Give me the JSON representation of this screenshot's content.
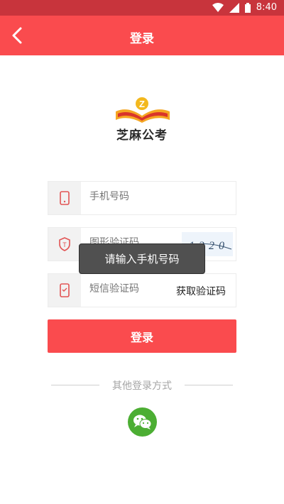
{
  "status_bar": {
    "time": "8:40",
    "icons": [
      "wifi-icon",
      "signal-icon",
      "battery-icon"
    ]
  },
  "header": {
    "title": "登录",
    "back_icon": "chevron-left-icon"
  },
  "logo": {
    "text": "芝麻公考",
    "badge_letter": "Z"
  },
  "form": {
    "phone": {
      "placeholder": "手机号码",
      "icon": "phone-icon"
    },
    "captcha": {
      "placeholder": "图形验证码",
      "icon": "shield-icon",
      "image_text": "1320"
    },
    "sms": {
      "placeholder": "短信验证码",
      "icon": "message-icon",
      "get_code_label": "获取验证码"
    }
  },
  "login_button": {
    "label": "登录"
  },
  "other_login": {
    "label": "其他登录方式",
    "wechat_icon": "wechat-icon"
  },
  "toast": {
    "message": "请输入手机号码"
  },
  "colors": {
    "primary": "#fa4b4e",
    "status_bar": "#c8343c",
    "wechat": "#4cae33"
  }
}
